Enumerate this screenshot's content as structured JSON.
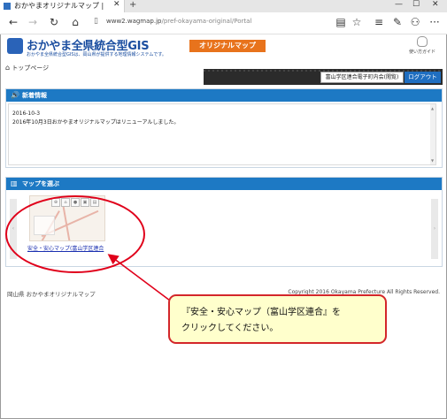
{
  "browser": {
    "tab_title": "おかやまオリジナルマップ | ",
    "url_host": "www2.wagmap.jp",
    "url_path": "/pref-okayama-original/Portal",
    "nav_icons": [
      "back-icon",
      "forward-icon",
      "refresh-icon",
      "home-icon"
    ],
    "toolbar_icons": [
      "reading-view-icon",
      "favorite-star-icon",
      "hub-icon",
      "web-note-icon",
      "share-icon",
      "more-icon"
    ]
  },
  "header": {
    "title": "おかやま全県統合型GIS",
    "subtitle": "おかやま全県統合型GISは、岡山県が提供する地理情報システムです。",
    "original_map_label": "オリジナルマップ",
    "guide_label": "使い方ガイド"
  },
  "breadcrumb": {
    "home_label": "トップページ"
  },
  "userbar": {
    "username": "富山学区連合電子町内会(閲覧)",
    "logout_label": "ログアウト"
  },
  "news": {
    "heading": "新着情報",
    "date": "2016-10-3",
    "text": "2016年10月3日おかやまオリジナルマップはリニューアルしました。"
  },
  "maps": {
    "heading": "マップを選ぶ",
    "items": [
      {
        "label": "安全・安心マップ(富山学区連合"
      }
    ]
  },
  "footer": {
    "left": "岡山県 おかやまオリジナルマップ",
    "right": "Copyright 2016 Okayama Prefecture All Rights Reserved."
  },
  "annotation": {
    "line1": "『安全・安心マップ（富山学区連合』を",
    "line2": "クリックしてください。",
    "color": "#e0001a",
    "fill": "#ffffcc"
  }
}
